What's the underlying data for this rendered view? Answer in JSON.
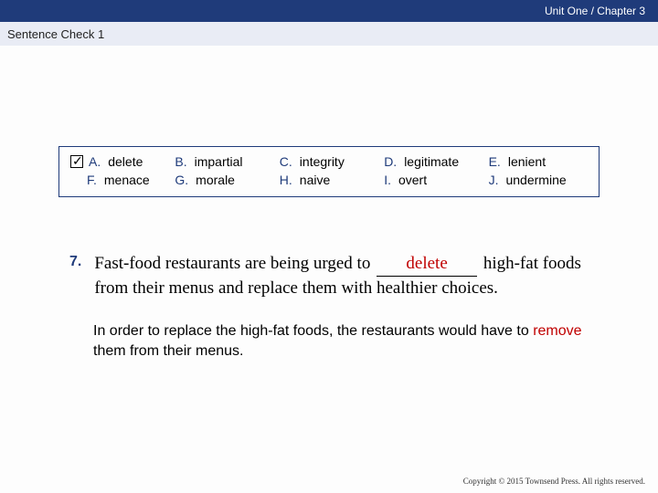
{
  "header": {
    "breadcrumb": "Unit One / Chapter 3",
    "section": "Sentence Check 1"
  },
  "words": {
    "row1": [
      {
        "letter": "A.",
        "word": "delete",
        "checked": true
      },
      {
        "letter": "B.",
        "word": "impartial",
        "checked": false
      },
      {
        "letter": "C.",
        "word": "integrity",
        "checked": false
      },
      {
        "letter": "D.",
        "word": "legitimate",
        "checked": false
      },
      {
        "letter": "E.",
        "word": "lenient",
        "checked": false
      }
    ],
    "row2": [
      {
        "letter": "F.",
        "word": "menace"
      },
      {
        "letter": "G.",
        "word": "morale"
      },
      {
        "letter": "H.",
        "word": "naive"
      },
      {
        "letter": "I.",
        "word": "overt"
      },
      {
        "letter": "J.",
        "word": "undermine"
      }
    ]
  },
  "question": {
    "number": "7.",
    "pre": "Fast-food restaurants are being urged to ",
    "answer": "delete",
    "post": " high-fat foods from their menus and replace them with healthier choices."
  },
  "explanation": {
    "pre": "In order to replace the high-fat foods, the restaurants would have to ",
    "keyword": "remove",
    "post": " them from their menus."
  },
  "footer": "Copyright © 2015 Townsend Press. All rights reserved."
}
